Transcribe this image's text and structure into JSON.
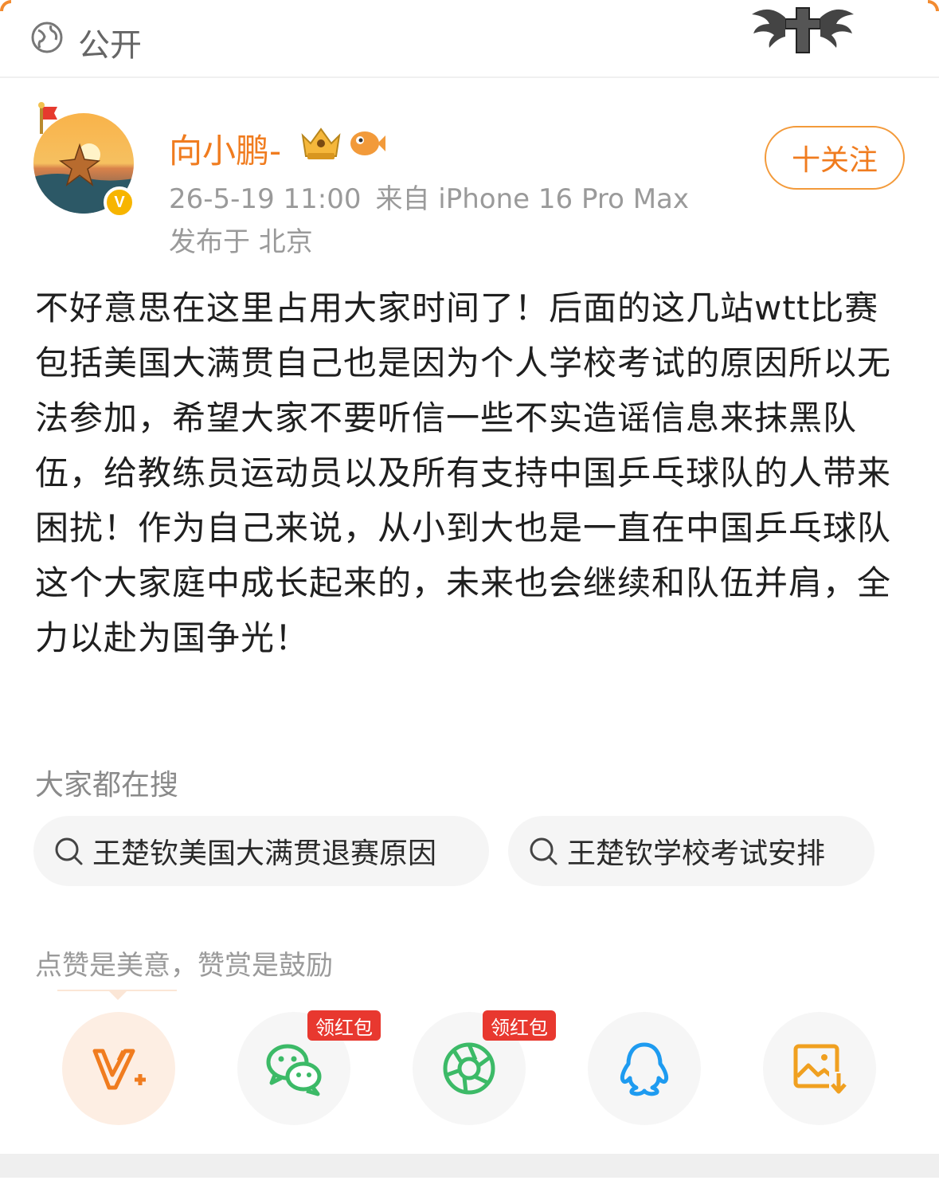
{
  "header": {
    "visibility_label": "公开"
  },
  "author": {
    "name": "向小鹏-",
    "verified_mark": "V",
    "timestamp": "26-5-19 11:00",
    "source": "来自 iPhone 16 Pro Max",
    "location": "发布于 北京"
  },
  "follow_button": {
    "label": "十关注"
  },
  "post": {
    "text": "不好意思在这里占用大家时间了！后面的这几站wtt比赛包括美国大满贯自己也是因为个人学校考试的原因所以无法参加，希望大家不要听信一些不实造谣信息来抹黑队伍，给教练员运动员以及所有支持中国乒乓球队的人带来困扰！作为自己来说，从小到大也是一直在中国乒乓球队这个大家庭中成长起来的，未来也会继续和队伍并肩，全力以赴为国争光！"
  },
  "trending": {
    "heading": "大家都在搜",
    "items": [
      {
        "label": "王楚钦美国大满贯退赛原因"
      },
      {
        "label": "王楚钦学校考试安排"
      }
    ]
  },
  "reward": {
    "note": "点赞是美意，赞赏是鼓励"
  },
  "share": {
    "items": [
      {
        "icon": "vplus-reward-icon"
      },
      {
        "icon": "wechat-icon",
        "badge": "领红包"
      },
      {
        "icon": "moments-icon",
        "badge": "领红包"
      },
      {
        "icon": "qq-icon"
      },
      {
        "icon": "save-image-icon"
      }
    ]
  },
  "colors": {
    "accent": "#f07c1f",
    "muted": "#9a9a9a",
    "badge_red": "#e8382f",
    "wechat_green": "#3cba67",
    "qq_blue": "#1e9bf0"
  }
}
